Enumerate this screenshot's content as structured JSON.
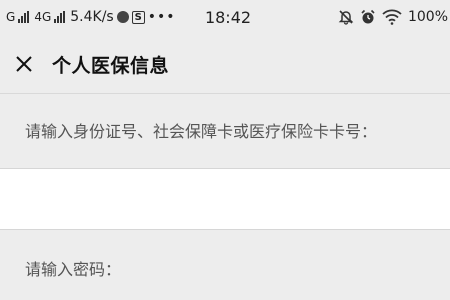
{
  "status_bar": {
    "carrier1": "G",
    "carrier2": "4G",
    "speed": "5.4K/s",
    "app_badge": "S",
    "more": "•••",
    "time": "18:42",
    "battery": "100%"
  },
  "header": {
    "title": "个人医保信息"
  },
  "form": {
    "id_label": "请输入身份证号、社会保障卡或医疗保险卡卡号：",
    "id_value": "",
    "password_label": "请输入密码："
  }
}
